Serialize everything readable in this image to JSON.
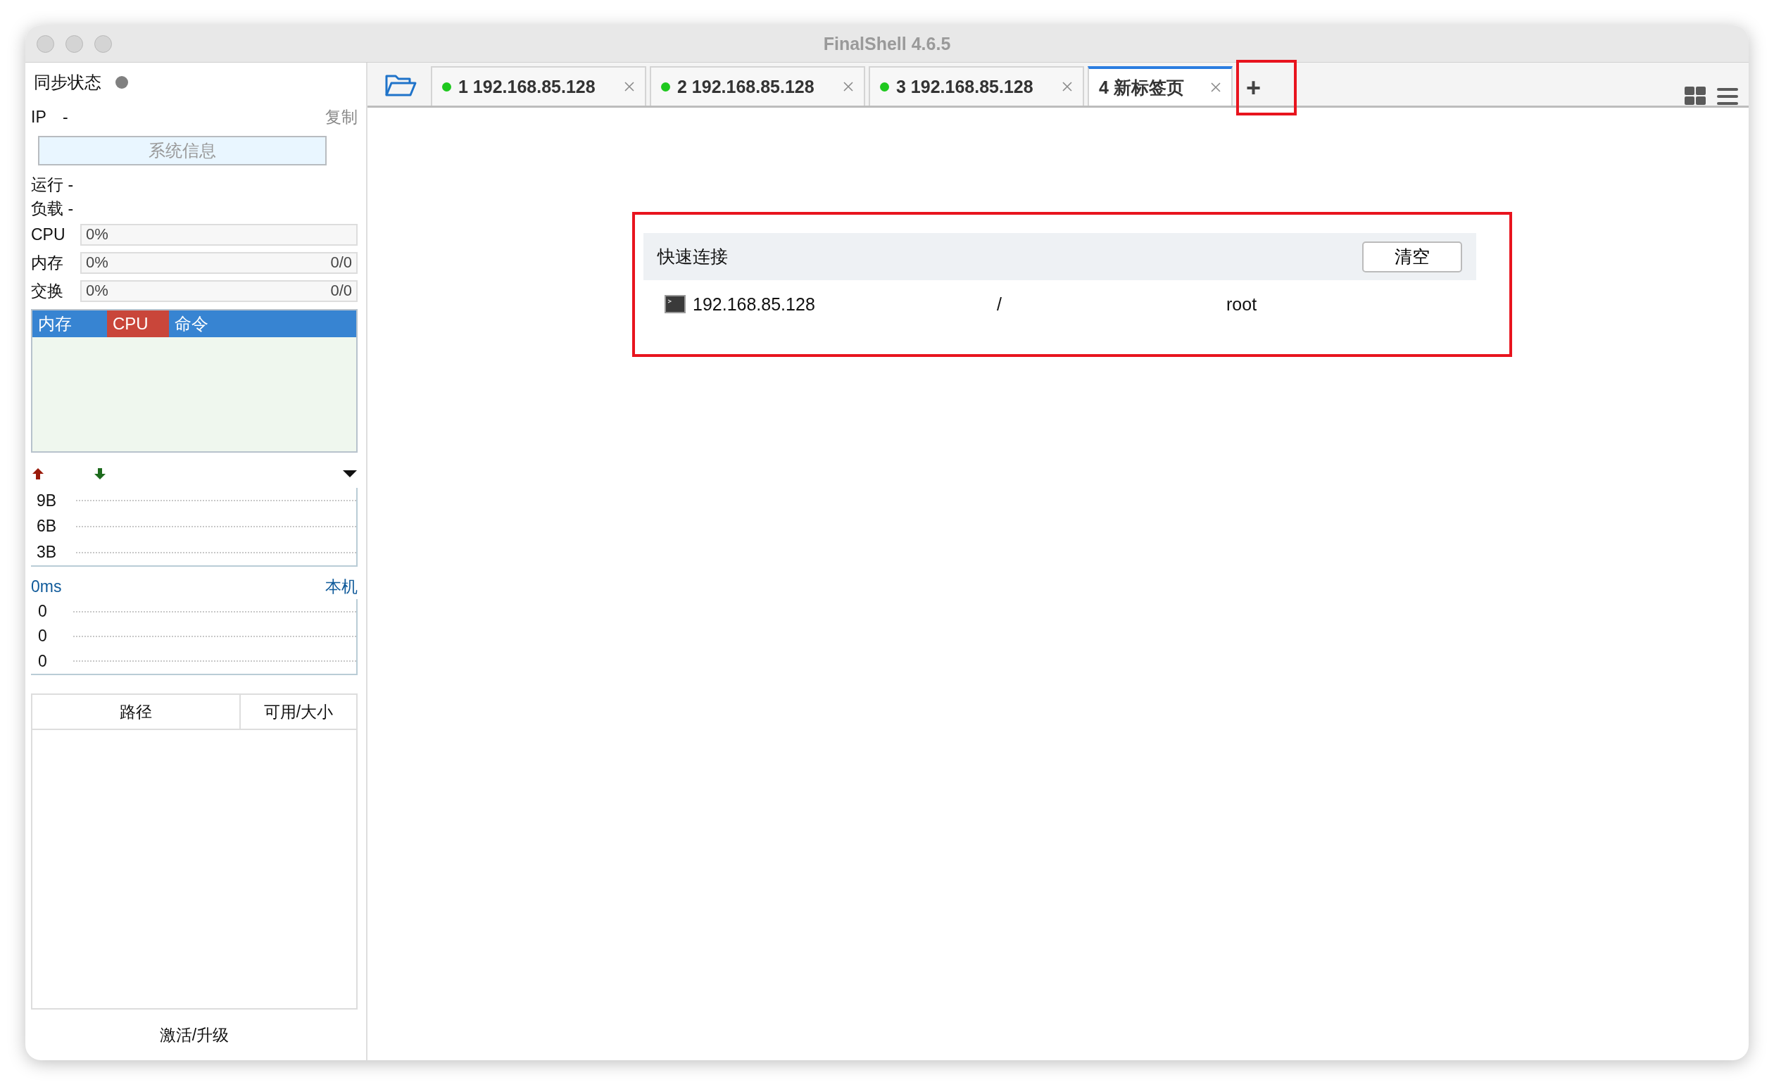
{
  "window": {
    "title": "FinalShell 4.6.5"
  },
  "sidebar": {
    "sync_label": "同步状态",
    "ip": {
      "label": "IP",
      "value": "-",
      "copy": "复制"
    },
    "sysinfo_button": "系统信息",
    "uptime": "运行 -",
    "load": "负载 -",
    "meters": [
      {
        "label": "CPU",
        "reading": "0%",
        "level": 0
      },
      {
        "label": "内存",
        "reading": "0%",
        "total": "0/0",
        "level": 0
      },
      {
        "label": "交换",
        "reading": "0%",
        "total": "0/0",
        "level": 0
      }
    ],
    "process_tabs": [
      {
        "label": "内存",
        "selected": false
      },
      {
        "label": "CPU",
        "selected": true
      },
      {
        "label": "命令",
        "selected": false
      }
    ],
    "network": {
      "yticks": [
        "9B",
        "6B",
        "3B"
      ]
    },
    "latency": {
      "reading": "0ms",
      "target": "本机",
      "rows": [
        "0",
        "0",
        "0"
      ]
    },
    "disk_table": {
      "columns": [
        "路径",
        "可用/大小"
      ]
    },
    "activate": "激活/升级"
  },
  "tabs": [
    {
      "number": "1",
      "label": "192.168.85.128",
      "connected": true,
      "selected": false
    },
    {
      "number": "2",
      "label": "192.168.85.128",
      "connected": true,
      "selected": false
    },
    {
      "number": "3",
      "label": "192.168.85.128",
      "connected": true,
      "selected": false
    },
    {
      "number": "4",
      "label": "新标签页",
      "connected": false,
      "selected": true
    }
  ],
  "new_tab_button": "+",
  "quick_connect": {
    "title": "快速连接",
    "clear_button": "清空",
    "rows": [
      {
        "host": "192.168.85.128",
        "path": "/",
        "user": "root"
      }
    ]
  }
}
